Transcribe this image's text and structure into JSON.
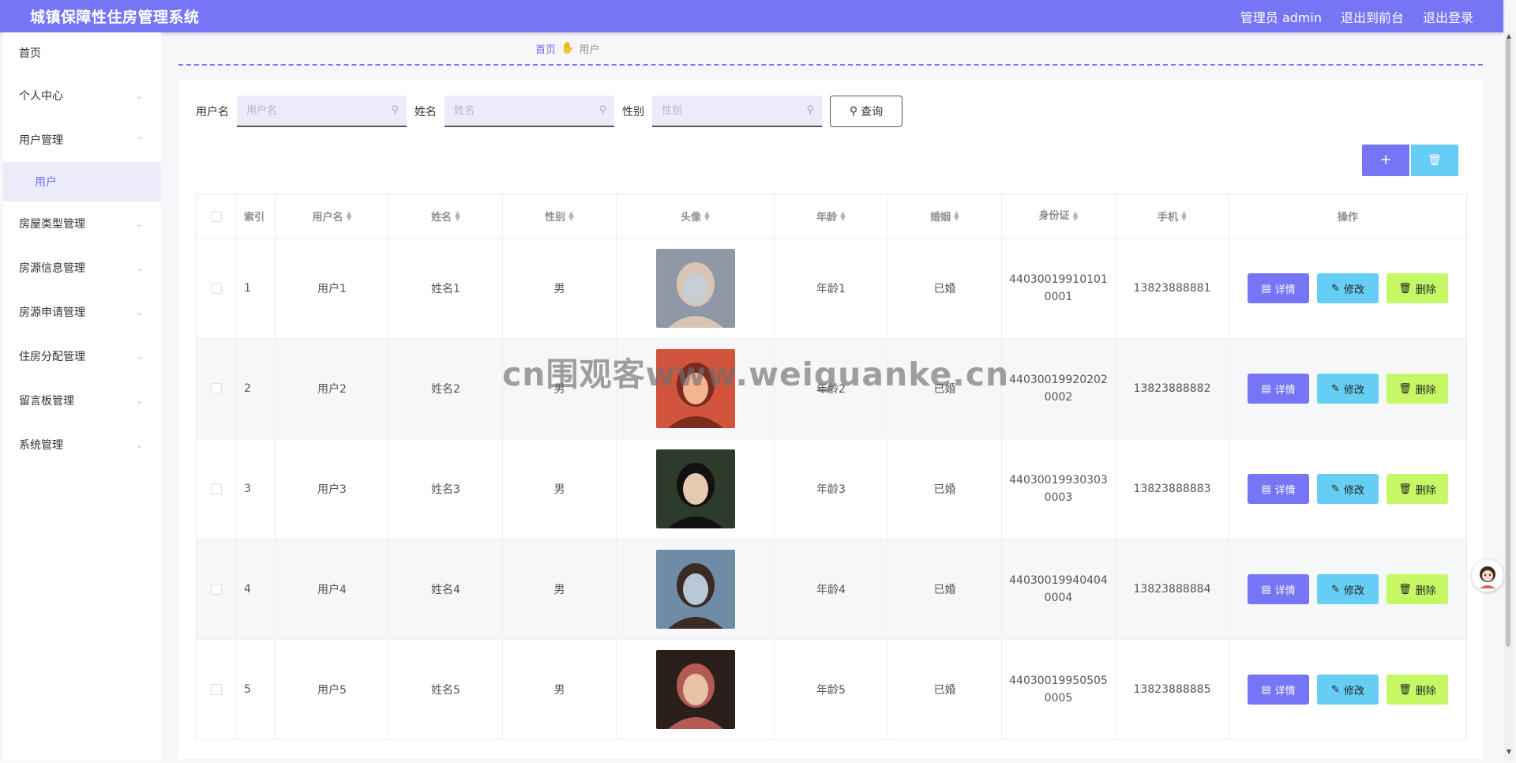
{
  "header": {
    "title": "城镇保障性住房管理系统",
    "admin_label": "管理员 admin",
    "front_label": "退出到前台",
    "logout_label": "退出登录"
  },
  "sidebar": {
    "items": [
      {
        "label": "首页"
      },
      {
        "label": "个人中心"
      },
      {
        "label": "用户管理"
      },
      {
        "label": "用户"
      },
      {
        "label": "房屋类型管理"
      },
      {
        "label": "房源信息管理"
      },
      {
        "label": "房源申请管理"
      },
      {
        "label": "住房分配管理"
      },
      {
        "label": "留言板管理"
      },
      {
        "label": "系统管理"
      }
    ]
  },
  "breadcrumb": {
    "home": "首页",
    "current": "用户"
  },
  "search": {
    "username_label": "用户名",
    "username_placeholder": "用户名",
    "name_label": "姓名",
    "name_placeholder": "姓名",
    "gender_label": "性别",
    "gender_placeholder": "性别",
    "query_label": "查询"
  },
  "toolbar": {
    "add_icon": "plus-icon",
    "delete_icon": "trash-icon"
  },
  "table": {
    "headers": {
      "index": "索引",
      "username": "用户名",
      "name": "姓名",
      "gender": "性别",
      "avatar": "头像",
      "age": "年龄",
      "marriage": "婚姻",
      "idcard": "身份证",
      "phone": "手机",
      "ops": "操作"
    },
    "ops": {
      "detail": "详情",
      "edit": "修改",
      "remove": "删除"
    },
    "rows": [
      {
        "index": "1",
        "username": "用户1",
        "name": "姓名1",
        "gender": "男",
        "age": "年龄1",
        "marriage": "已婚",
        "idcard": "440300199101010001",
        "phone": "13823888881"
      },
      {
        "index": "2",
        "username": "用户2",
        "name": "姓名2",
        "gender": "男",
        "age": "年龄2",
        "marriage": "已婚",
        "idcard": "440300199202020002",
        "phone": "13823888882"
      },
      {
        "index": "3",
        "username": "用户3",
        "name": "姓名3",
        "gender": "男",
        "age": "年龄3",
        "marriage": "已婚",
        "idcard": "440300199303030003",
        "phone": "13823888883"
      },
      {
        "index": "4",
        "username": "用户4",
        "name": "姓名4",
        "gender": "男",
        "age": "年龄4",
        "marriage": "已婚",
        "idcard": "440300199404040004",
        "phone": "13823888884"
      },
      {
        "index": "5",
        "username": "用户5",
        "name": "姓名5",
        "gender": "男",
        "age": "年龄5",
        "marriage": "已婚",
        "idcard": "440300199505050005",
        "phone": "13823888885"
      }
    ]
  },
  "watermark": "cn围观客www.weiguanke.cn",
  "colors": {
    "primary": "#7575f5",
    "edit": "#66cdf4",
    "remove": "#c4f864"
  }
}
